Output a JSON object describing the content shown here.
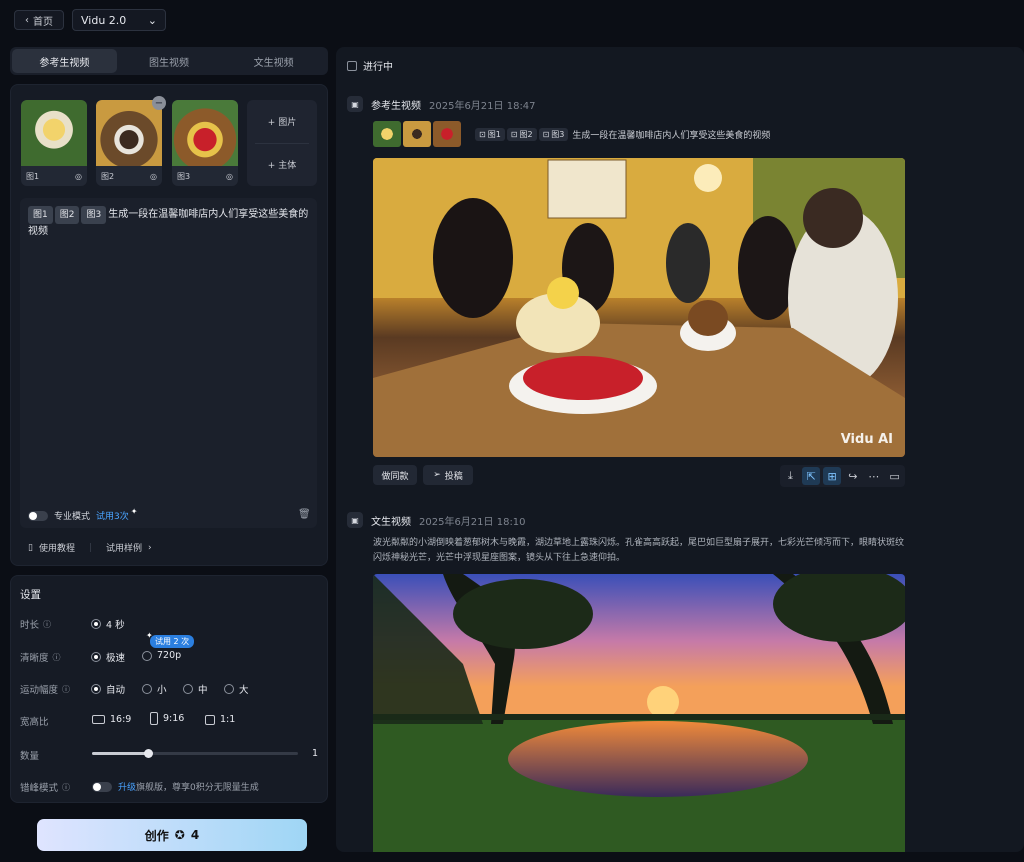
{
  "nav": {
    "home_label": "首页",
    "model": "Vidu 2.0"
  },
  "tabs": [
    "参考生视频",
    "图生视频",
    "文生视频"
  ],
  "references": [
    {
      "label": "图1"
    },
    {
      "label": "图2"
    },
    {
      "label": "图3"
    }
  ],
  "add_box": {
    "image": "+ 图片",
    "subject": "+ 主体"
  },
  "prompt": {
    "tags": [
      "图1",
      "图2",
      "图3"
    ],
    "text": "生成一段在温馨咖啡店内人们享受这些美食的视频"
  },
  "pro_mode": {
    "label": "专业模式",
    "trial": "试用3次"
  },
  "footer_links": {
    "tutorial": "使用教程",
    "samples": "试用样例"
  },
  "settings": {
    "title": "设置",
    "duration": {
      "label": "时长",
      "options": [
        "4 秒"
      ]
    },
    "clarity": {
      "label": "清晰度",
      "options": [
        "极速",
        "720p"
      ],
      "badge": "试用 2 次"
    },
    "motion": {
      "label": "运动幅度",
      "options": [
        "自动",
        "小",
        "中",
        "大"
      ]
    },
    "aspect": {
      "label": "宽高比",
      "options": [
        "16:9",
        "9:16",
        "1:1"
      ]
    },
    "count": {
      "label": "数量",
      "value": "1",
      "level": 0.27
    },
    "offpeak": {
      "label": "错峰模式",
      "link": "升级",
      "text": "旗舰版，尊享0积分无限量生成"
    }
  },
  "create_button": {
    "label": "创作",
    "cost": "4"
  },
  "right": {
    "in_progress": "进行中",
    "items": [
      {
        "type": "参考生视频",
        "time": "2025年6月21日 18:47",
        "pills": [
          "图1",
          "图2",
          "图3"
        ],
        "prompt": "生成一段在温馨咖啡店内人们享受这些美食的视频",
        "watermark": "Vidu AI",
        "redo": "做同款",
        "submit": "投稿"
      },
      {
        "type": "文生视频",
        "time": "2025年6月21日 18:10",
        "prompt": "波光粼粼的小湖倒映着葱郁树木与晚霞，湖边草地上露珠闪烁。孔雀高高跃起，尾巴如巨型扇子展开，七彩光芒倾泻而下，眼睛状斑纹闪烁神秘光芒，光芒中浮现星座图案，镜头从下往上急速仰拍。"
      }
    ]
  },
  "colors": {
    "accent": "#4aa3ff",
    "bg": "#0b0e15",
    "panel": "#161b25"
  }
}
